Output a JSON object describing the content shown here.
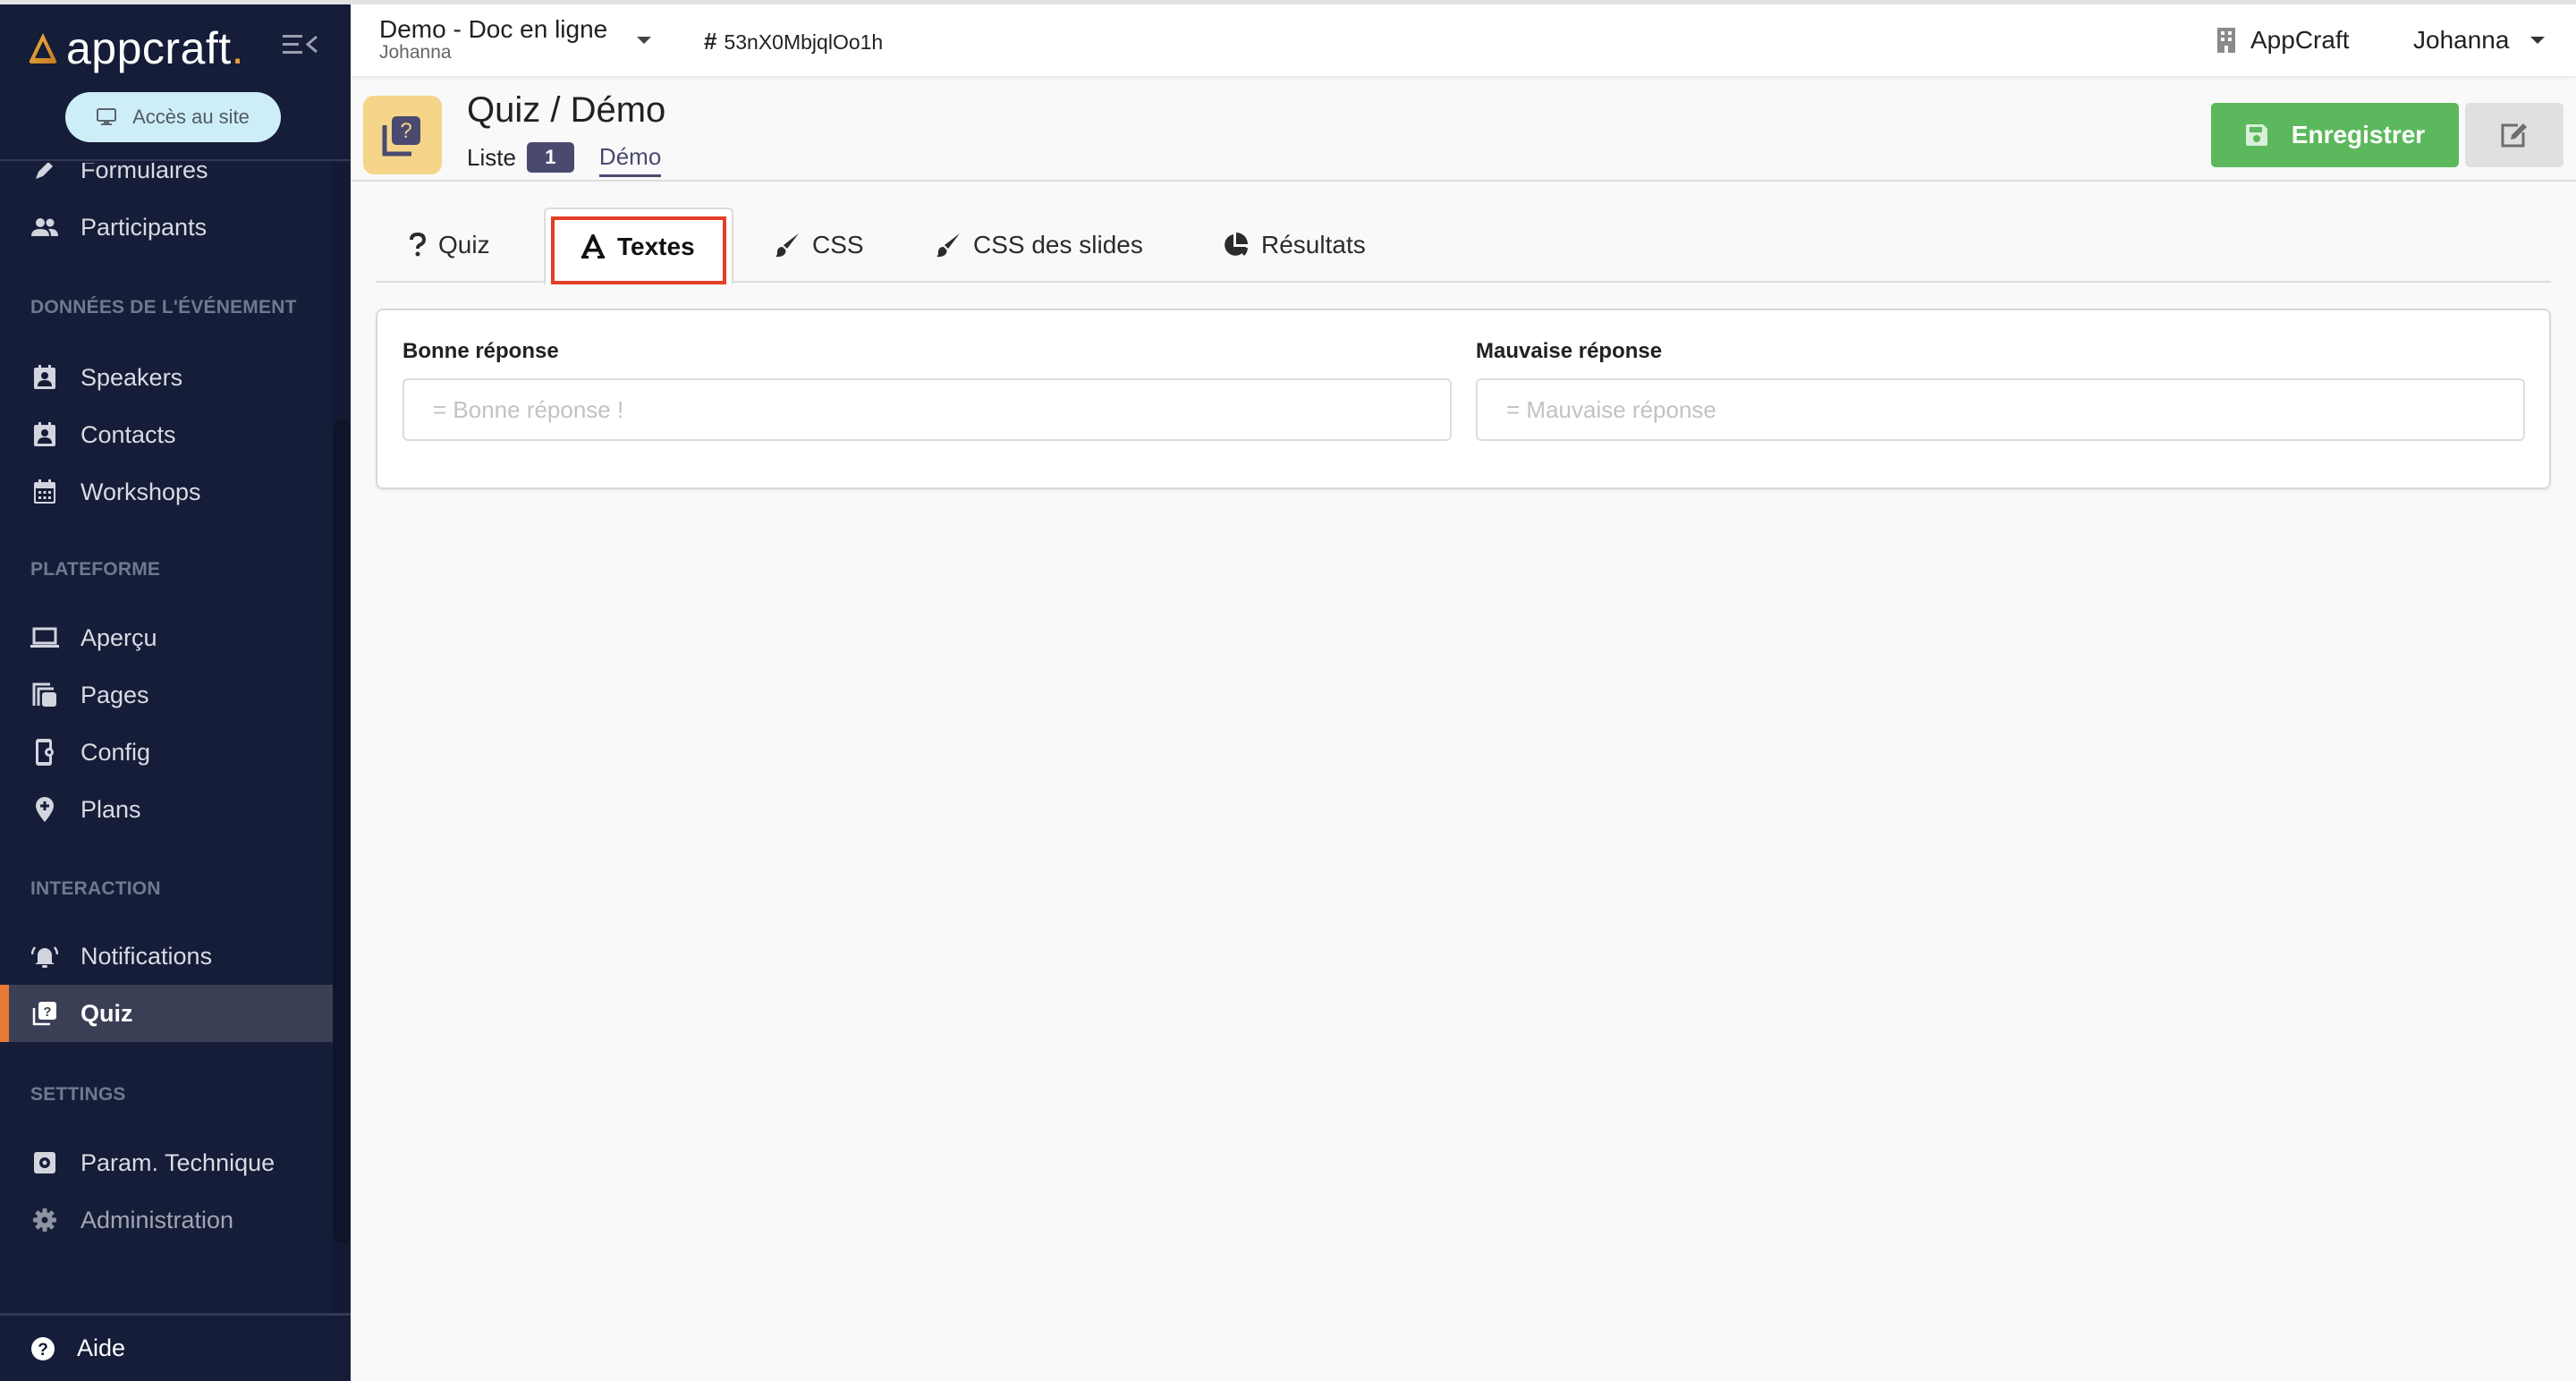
{
  "sidebar": {
    "logo_text": "appcraft",
    "logo_dot": ".",
    "site_button": "Accès au site",
    "items": [
      {
        "label": "Formulaires"
      },
      {
        "label": "Participants"
      },
      {
        "label": "Speakers"
      },
      {
        "label": "Contacts"
      },
      {
        "label": "Workshops"
      },
      {
        "label": "Aperçu"
      },
      {
        "label": "Pages"
      },
      {
        "label": "Config"
      },
      {
        "label": "Plans"
      },
      {
        "label": "Notifications"
      },
      {
        "label": "Quiz"
      },
      {
        "label": "Param. Technique"
      },
      {
        "label": "Administration"
      }
    ],
    "sections": {
      "event_data": "DONNÉES DE L'ÉVÉNEMENT",
      "platform": "PLATEFORME",
      "interaction": "INTERACTION",
      "settings": "SETTINGS"
    },
    "active_item": "Quiz",
    "help": "Aide",
    "colors": {
      "background": "#161d38",
      "active_accent": "#e87a38",
      "logo_accent": "#e8a23a"
    }
  },
  "header": {
    "project_name": "Demo - Doc en ligne",
    "project_user": "Johanna",
    "project_id": "53nX0MbjqlOo1h",
    "organization": "AppCraft",
    "user_name": "Johanna"
  },
  "page": {
    "title": "Quiz / Démo",
    "nav_list": "Liste",
    "nav_list_count": "1",
    "nav_current": "Démo",
    "save_button": "Enregistrer",
    "colors": {
      "save": "#5cb85c",
      "icon_bg": "#f4d58a",
      "badge": "#4a4a70"
    }
  },
  "tabs": [
    {
      "label": "Quiz",
      "icon": "question-icon"
    },
    {
      "label": "Textes",
      "icon": "font-icon",
      "active": true
    },
    {
      "label": "CSS",
      "icon": "brush-icon"
    },
    {
      "label": "CSS des slides",
      "icon": "brush-icon"
    },
    {
      "label": "Résultats",
      "icon": "pie-chart-icon"
    }
  ],
  "form": {
    "good_answer": {
      "label": "Bonne réponse",
      "value": "",
      "placeholder": "= Bonne réponse !"
    },
    "bad_answer": {
      "label": "Mauvaise réponse",
      "value": "",
      "placeholder": "= Mauvaise réponse"
    }
  }
}
